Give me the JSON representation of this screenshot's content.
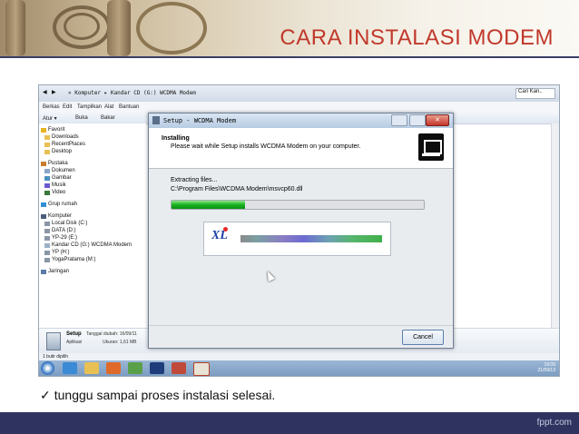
{
  "slide": {
    "title": "CARA INSTALASI MODEM",
    "caption": "tunggu sampai proses instalasi  selesai.",
    "watermark": "fppt.com"
  },
  "explorer": {
    "address": "« Komputer ▸ Kandar CD (G:) WCDMA Modem",
    "search_placeholder": "Cari Kan..",
    "menu": [
      "Berkas",
      "Edit",
      "Tampilkan",
      "Alat",
      "Bantuan"
    ],
    "toolbar": [
      "Atur ▾",
      "Buka",
      "Bakar"
    ],
    "nav": [
      {
        "label": "Favorit",
        "icon": "star-icon",
        "group": true
      },
      {
        "label": "Downloads",
        "icon": "folder-icon"
      },
      {
        "label": "RecentPlaces",
        "icon": "folder-icon"
      },
      {
        "label": "Desktop",
        "icon": "folder-icon"
      },
      {
        "label": "Pustaka",
        "icon": "library-icon",
        "group": true
      },
      {
        "label": "Dokumen",
        "icon": "document-icon"
      },
      {
        "label": "Gambar",
        "icon": "picture-icon"
      },
      {
        "label": "Musik",
        "icon": "music-icon"
      },
      {
        "label": "Video",
        "icon": "video-icon"
      },
      {
        "label": "Grup rumah",
        "icon": "homegroup-icon",
        "group": true
      },
      {
        "label": "Komputer",
        "icon": "computer-icon",
        "group": true
      },
      {
        "label": "Local Disk (C:)",
        "icon": "drive-icon"
      },
      {
        "label": "DATA (D:)",
        "icon": "drive-icon"
      },
      {
        "label": "YP-29 (E:)",
        "icon": "drive-icon"
      },
      {
        "label": "Kandar CD (G:) WCDMA Modem",
        "icon": "cd-icon"
      },
      {
        "label": "YP (H:)",
        "icon": "drive-icon"
      },
      {
        "label": "YogaPratama (M:)",
        "icon": "drive-icon"
      },
      {
        "label": "Jaringan",
        "icon": "network-icon",
        "group": true
      }
    ],
    "details": {
      "name": "Setup",
      "type": "Aplikasi",
      "date_label": "Tanggal diubah: 16/09/11",
      "size_label": "Ukuran: 1,61 MB"
    },
    "status": "1 butir dipilih",
    "clock": {
      "time": "19:09",
      "date": "21/09/13"
    }
  },
  "dialog": {
    "title": "Setup - WCDMA Modem",
    "heading": "Installing",
    "subheading": "Please wait while Setup installs WCDMA Modem on your computer.",
    "status_line": "Extracting files...",
    "file_path": "C:\\Program Files\\WCDMA Modem\\msvcp60.dll",
    "progress_percent": 29,
    "logo_text": "XL",
    "cancel_label": "Cancel"
  },
  "colors": {
    "title": "#c0392b",
    "footer": "#2e3360",
    "progress": "#17b420"
  }
}
